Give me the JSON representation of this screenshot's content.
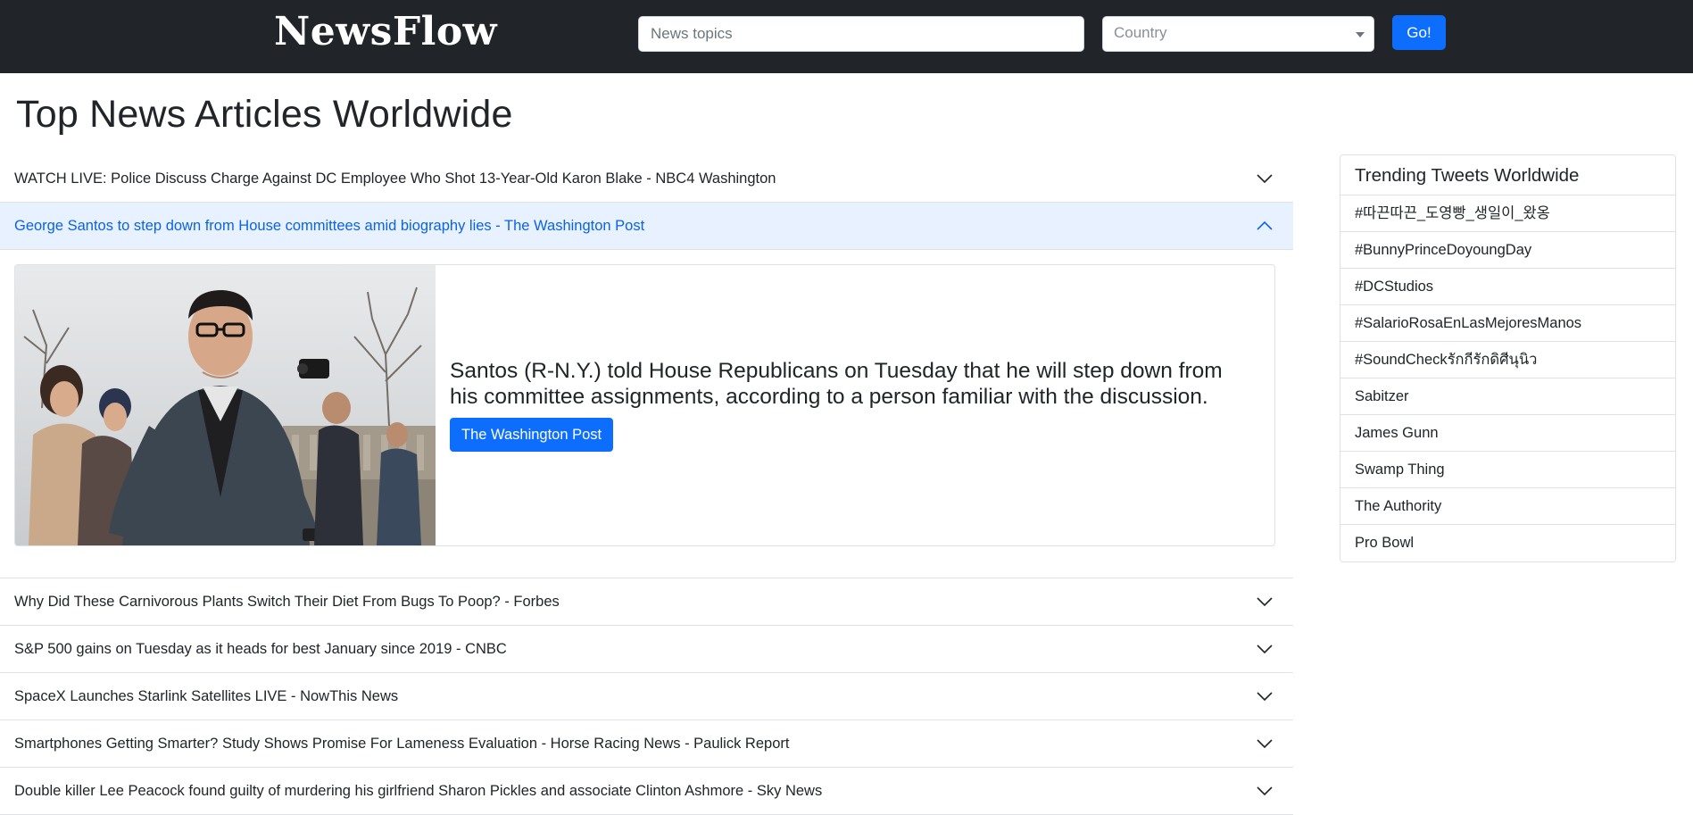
{
  "brand": "NewsFlow",
  "search": {
    "placeholder": "News topics"
  },
  "country": {
    "placeholder": "Country"
  },
  "go_label": "Go!",
  "page_title": "Top News Articles Worldwide",
  "articles": [
    {
      "title": "WATCH LIVE: Police Discuss Charge Against DC Employee Who Shot 13-Year-Old Karon Blake - NBC4 Washington",
      "expanded": false
    },
    {
      "title": "George Santos to step down from House committees amid biography lies - The Washington Post",
      "expanded": true,
      "description": "Santos (R-N.Y.) told House Republicans on Tuesday that he will step down from his committee assignments, according to a person familiar with the discussion.",
      "source_button": "The Washington Post"
    },
    {
      "title": "Why Did These Carnivorous Plants Switch Their Diet From Bugs To Poop? - Forbes",
      "expanded": false
    },
    {
      "title": "S&P 500 gains on Tuesday as it heads for best January since 2019 - CNBC",
      "expanded": false
    },
    {
      "title": "SpaceX Launches Starlink Satellites LIVE - NowThis News",
      "expanded": false
    },
    {
      "title": "Smartphones Getting Smarter? Study Shows Promise For Lameness Evaluation - Horse Racing News - Paulick Report",
      "expanded": false
    },
    {
      "title": "Double killer Lee Peacock found guilty of murdering his girlfriend Sharon Pickles and associate Clinton Ashmore - Sky News",
      "expanded": false
    }
  ],
  "trending": {
    "title": "Trending Tweets Worldwide",
    "items": [
      "#따끈따끈_도영빵_생일이_왔옹",
      "#BunnyPrinceDoyoungDay",
      "#DCStudios",
      "#SalarioRosaEnLasMejoresManos",
      "#SoundCheckรักกีรักดิศีนุนิว",
      "Sabitzer",
      "James Gunn",
      "Swamp Thing",
      "The Authority",
      "Pro Bowl"
    ]
  },
  "colors": {
    "navbar": "#212529",
    "primary": "#0d6efd",
    "active_bg": "#e7f1ff",
    "active_text": "#0c63e4"
  }
}
